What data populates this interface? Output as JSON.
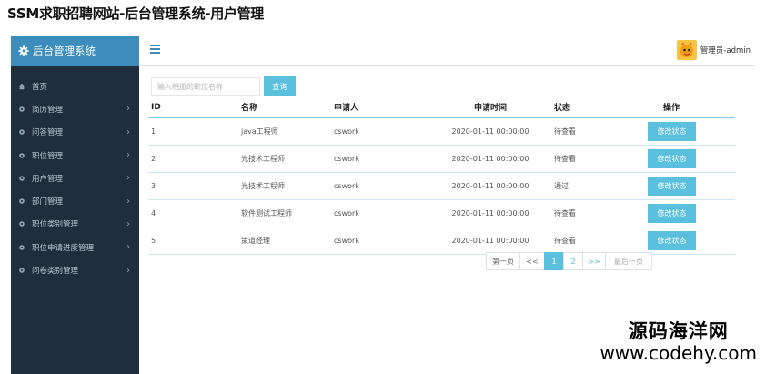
{
  "page_heading": "SSM求职招聘网站-后台管理系统-用户管理",
  "sidebar": {
    "title": "后台管理系统",
    "title_icon": "gear-icon",
    "items": [
      {
        "label": "首页",
        "has_children": false
      },
      {
        "label": "简历管理",
        "has_children": true
      },
      {
        "label": "问答管理",
        "has_children": true
      },
      {
        "label": "职位管理",
        "has_children": true
      },
      {
        "label": "用户管理",
        "has_children": true
      },
      {
        "label": "部门管理",
        "has_children": true
      },
      {
        "label": "职位类别管理",
        "has_children": true
      },
      {
        "label": "职位申请进度管理",
        "has_children": true
      },
      {
        "label": "问卷类别管理",
        "has_children": true
      }
    ]
  },
  "topbar": {
    "user_name": "管理员-admin"
  },
  "search": {
    "placeholder": "输入相册的职位名称",
    "button_label": "查询"
  },
  "table": {
    "headers": {
      "id": "ID",
      "name": "名称",
      "applicant": "申请人",
      "time": "申请时间",
      "status": "状态",
      "op": "操作"
    },
    "rows": [
      {
        "id": "1",
        "name": "java工程师",
        "applicant": "cswork",
        "time": "2020-01-11 00:00:00",
        "status": "待查看",
        "action": "修改状态"
      },
      {
        "id": "2",
        "name": "光技术工程师",
        "applicant": "cswork",
        "time": "2020-01-11 00:00:00",
        "status": "待查看",
        "action": "修改状态"
      },
      {
        "id": "3",
        "name": "光技术工程师",
        "applicant": "cswork",
        "time": "2020-01-11 00:00:00",
        "status": "通过",
        "action": "修改状态"
      },
      {
        "id": "4",
        "name": "软件测试工程师",
        "applicant": "cswork",
        "time": "2020-01-11 00:00:00",
        "status": "待查看",
        "action": "修改状态"
      },
      {
        "id": "5",
        "name": "策道经理",
        "applicant": "cswork",
        "time": "2020-01-11 00:00:00",
        "status": "待查看",
        "action": "修改状态"
      }
    ]
  },
  "pagination": {
    "first": "第一页",
    "prev": "<<",
    "pages": [
      "1",
      "2"
    ],
    "current": "1",
    "next": ">>",
    "last": "最后一页"
  },
  "watermark": {
    "line1": "源码海洋网",
    "line2": "www.codehy.com"
  },
  "colors": {
    "sidebar_bg": "#1f2d3d",
    "accent": "#3c8dbc",
    "button": "#5bc0de"
  }
}
